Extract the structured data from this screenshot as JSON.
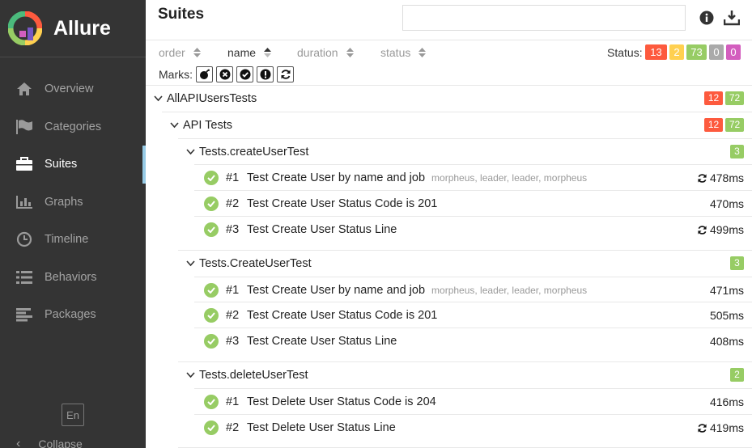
{
  "app": {
    "name": "Allure"
  },
  "sidebar": {
    "items": [
      {
        "label": "Overview",
        "icon": "home-icon"
      },
      {
        "label": "Categories",
        "icon": "flag-icon"
      },
      {
        "label": "Suites",
        "icon": "briefcase-icon",
        "active": true
      },
      {
        "label": "Graphs",
        "icon": "bar-chart-icon"
      },
      {
        "label": "Timeline",
        "icon": "clock-icon"
      },
      {
        "label": "Behaviors",
        "icon": "list-icon"
      },
      {
        "label": "Packages",
        "icon": "align-left-icon"
      }
    ],
    "language": "En",
    "collapse_label": "Collapse"
  },
  "header": {
    "title": "Suites",
    "search_placeholder": ""
  },
  "sortbar": {
    "order": "order",
    "name": "name",
    "duration": "duration",
    "status": "status",
    "status_label": "Status:",
    "marks_label": "Marks:"
  },
  "status_counts": {
    "failed": "13",
    "broken": "2",
    "passed": "73",
    "skipped": "0",
    "unknown": "0"
  },
  "colors": {
    "failed": "#fd5a3e",
    "broken": "#ffd050",
    "passed": "#97cc64",
    "skipped": "#aaaaaa",
    "unknown": "#d35ebe",
    "sidebar": "#343434",
    "active_marker": "#97cbe6"
  },
  "tree": {
    "root": {
      "name": "AllAPIUsersTests",
      "failed": "12",
      "passed": "72"
    },
    "suite": {
      "name": "API Tests",
      "failed": "12",
      "passed": "72"
    },
    "groups": [
      {
        "name": "Tests.createUserTest",
        "passed": "3",
        "tests": [
          {
            "num": "#1",
            "name": "Test Create User by name and job",
            "params": "morpheus, leader, leader, morpheus",
            "duration": "478ms",
            "retried": true
          },
          {
            "num": "#2",
            "name": "Test Create User Status Code is 201",
            "params": "",
            "duration": "470ms",
            "retried": false
          },
          {
            "num": "#3",
            "name": "Test Create User Status Line",
            "params": "",
            "duration": "499ms",
            "retried": true
          }
        ]
      },
      {
        "name": "Tests.CreateUserTest",
        "passed": "3",
        "tests": [
          {
            "num": "#1",
            "name": "Test Create User by name and job",
            "params": "morpheus, leader, leader, morpheus",
            "duration": "471ms",
            "retried": false
          },
          {
            "num": "#2",
            "name": "Test Create User Status Code is 201",
            "params": "",
            "duration": "505ms",
            "retried": false
          },
          {
            "num": "#3",
            "name": "Test Create User Status Line",
            "params": "",
            "duration": "408ms",
            "retried": false
          }
        ]
      },
      {
        "name": "Tests.deleteUserTest",
        "passed": "2",
        "tests": [
          {
            "num": "#1",
            "name": "Test Delete User Status Code is 204",
            "params": "",
            "duration": "416ms",
            "retried": false
          },
          {
            "num": "#2",
            "name": "Test Delete User Status Line",
            "params": "",
            "duration": "419ms",
            "retried": true
          }
        ]
      }
    ]
  }
}
